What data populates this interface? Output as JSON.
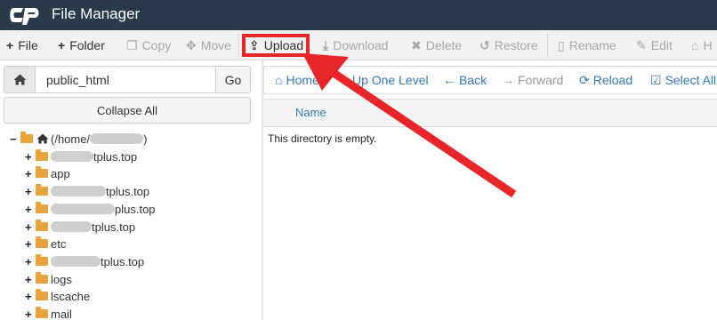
{
  "app": {
    "title": "File Manager",
    "logo_icon": "cpanel-logo-icon"
  },
  "toolbar": {
    "items": [
      {
        "label": "File",
        "icon": "plus-icon",
        "glyph": "+",
        "enabled": true
      },
      {
        "label": "Folder",
        "icon": "plus-icon",
        "glyph": "+",
        "enabled": true
      },
      {
        "label": "Copy",
        "icon": "copy-icon",
        "glyph": "❐",
        "enabled": false
      },
      {
        "label": "Move",
        "icon": "move-icon",
        "glyph": "✥",
        "enabled": false
      },
      {
        "label": "Upload",
        "icon": "upload-icon",
        "glyph": "⇪",
        "enabled": true
      },
      {
        "label": "Download",
        "icon": "download-icon",
        "glyph": "⤓",
        "enabled": false
      },
      {
        "label": "Delete",
        "icon": "delete-icon",
        "glyph": "✖",
        "enabled": false
      },
      {
        "label": "Restore",
        "icon": "restore-icon",
        "glyph": "↺",
        "enabled": false
      },
      {
        "label": "Rename",
        "icon": "rename-icon",
        "glyph": "▯",
        "enabled": false
      },
      {
        "label": "Edit",
        "icon": "edit-icon",
        "glyph": "✎",
        "enabled": false
      },
      {
        "label": "H",
        "icon": "html-editor-icon",
        "glyph": "⌂",
        "enabled": false
      }
    ]
  },
  "left_panel": {
    "home_icon": "home-icon",
    "path_value": "public_html",
    "go_label": "Go",
    "collapse_label": "Collapse All",
    "tree": [
      {
        "toggle": "−",
        "text": "(/home/",
        "suffix": ")",
        "redacted": true,
        "root": true
      },
      {
        "toggle": "+",
        "text": "",
        "suffix": "tplus.top",
        "redacted": true
      },
      {
        "toggle": "+",
        "text": "app",
        "suffix": "",
        "redacted": false
      },
      {
        "toggle": "+",
        "text": "",
        "suffix": "tplus.top",
        "redacted": true
      },
      {
        "toggle": "+",
        "text": "",
        "suffix": "plus.top",
        "redacted": true
      },
      {
        "toggle": "+",
        "text": "",
        "suffix": "tplus.top",
        "redacted": true
      },
      {
        "toggle": "+",
        "text": "etc",
        "suffix": "",
        "redacted": false
      },
      {
        "toggle": "+",
        "text": "",
        "suffix": "tplus.top",
        "redacted": true
      },
      {
        "toggle": "+",
        "text": "logs",
        "suffix": "",
        "redacted": false
      },
      {
        "toggle": "+",
        "text": "lscache",
        "suffix": "",
        "redacted": false
      },
      {
        "toggle": "+",
        "text": "mail",
        "suffix": "",
        "redacted": false
      }
    ]
  },
  "nav": {
    "items": [
      {
        "label": "Home",
        "icon": "home-icon",
        "glyph": "⌂",
        "enabled": true
      },
      {
        "label": "Up One Level",
        "icon": "arrow-up-icon",
        "glyph": "↑",
        "enabled": true
      },
      {
        "label": "Back",
        "icon": "arrow-left-icon",
        "glyph": "←",
        "enabled": true
      },
      {
        "label": "Forward",
        "icon": "arrow-right-icon",
        "glyph": "→",
        "enabled": false
      },
      {
        "label": "Reload",
        "icon": "reload-icon",
        "glyph": "⟳",
        "enabled": true
      },
      {
        "label": "Select All",
        "icon": "checkbox-icon",
        "glyph": "☑",
        "enabled": true
      }
    ]
  },
  "file_list": {
    "columns": [
      "Name"
    ],
    "empty_message": "This directory is empty."
  },
  "annotation": {
    "color": "#e8262a",
    "target": "Upload"
  },
  "colors": {
    "titlebar": "#293a4a",
    "link": "#337ab7",
    "folder": "#e8a33d"
  }
}
